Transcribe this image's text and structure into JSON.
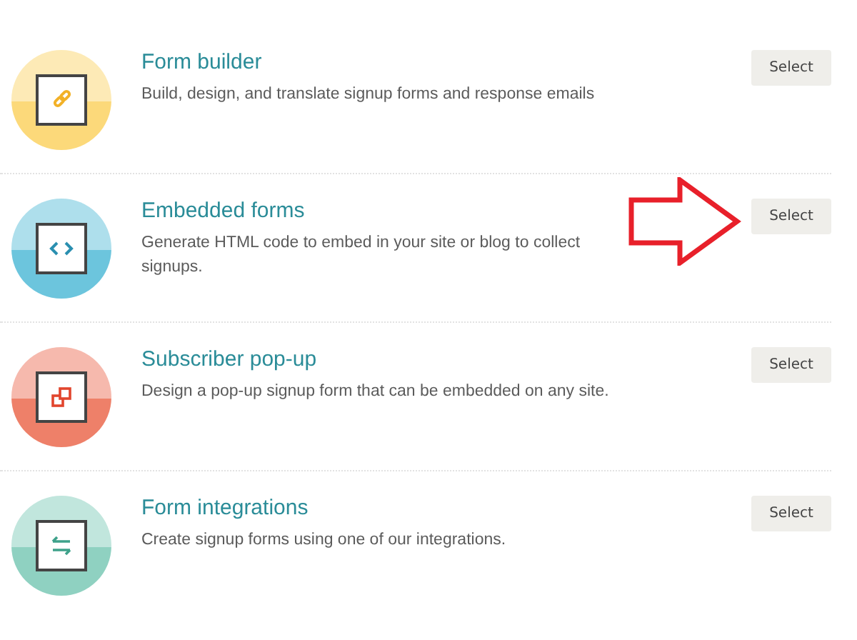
{
  "options": [
    {
      "kind": "link",
      "color": "#fcd97a",
      "title": "Form builder",
      "description": "Build, design, and translate signup forms and response emails",
      "button": "Select",
      "highlighted": false
    },
    {
      "kind": "code",
      "color": "#6cc5dd",
      "title": "Embedded forms",
      "description": "Generate HTML code to embed in your site or blog to collect signups.",
      "button": "Select",
      "highlighted": true
    },
    {
      "kind": "popup",
      "color": "#ee8069",
      "title": "Subscriber pop-up",
      "description": "Design a pop-up signup form that can be embedded on any site.",
      "button": "Select",
      "highlighted": false
    },
    {
      "kind": "swap",
      "color": "#8fd1c1",
      "title": "Form integrations",
      "description": "Create signup forms using one of our integrations.",
      "button": "Select",
      "highlighted": false
    }
  ]
}
